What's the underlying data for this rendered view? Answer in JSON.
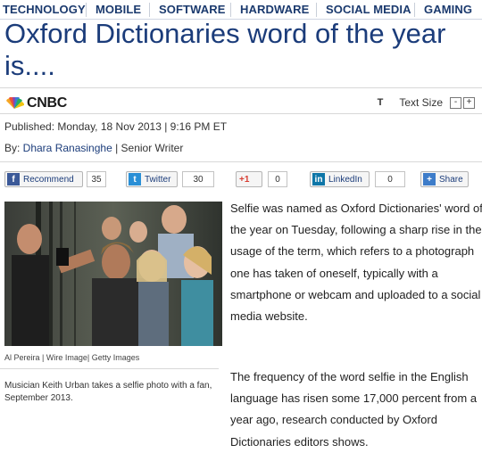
{
  "nav": {
    "items": [
      "TECHNOLOGY",
      "MOBILE",
      "SOFTWARE",
      "HARDWARE",
      "SOCIAL MEDIA",
      "GAMING"
    ]
  },
  "article": {
    "headline": "Oxford Dictionaries word of the year is....",
    "source": "CNBC",
    "text_size_label": "Text Size",
    "text_size_icon": "T",
    "text_size_decrease": "-",
    "text_size_increase": "+",
    "published": "Published: Monday, 18 Nov 2013 | 9:16 PM ET",
    "by_prefix": "By: ",
    "author": "Dhara Ranasinghe",
    "author_role": " | Senior Writer",
    "paragraph1": "Selfie was named as Oxford Dictionaries' word of the year on Tuesday, following a sharp rise in the usage of the term, which refers to a photograph one has taken of oneself, typically with a smartphone or webcam and uploaded to a social media website.",
    "paragraph2": "The frequency of the word selfie in the English language has risen some 17,000 percent from a year ago, research conducted by Oxford Dictionaries editors shows.",
    "photo_credit": "Al Pereira | Wire Image| Getty Images",
    "photo_caption": "Musician Keith Urban takes a selfie photo with a fan, September 2013."
  },
  "share": {
    "facebook_label": "Recommend",
    "facebook_count": "35",
    "twitter_label": "Twitter",
    "twitter_count": "30",
    "gplus_label": "+1",
    "gplus_count": "0",
    "linkedin_label": "LinkedIn",
    "linkedin_count": "0",
    "share_label": "Share"
  },
  "colors": {
    "nav_text": "#1b3a6e",
    "headline": "#1b3c7a",
    "facebook": "#3b5998",
    "twitter": "#2a8fd6",
    "gplus": "#d73d32",
    "linkedin": "#0e76a8",
    "share": "#3d7cc9"
  }
}
